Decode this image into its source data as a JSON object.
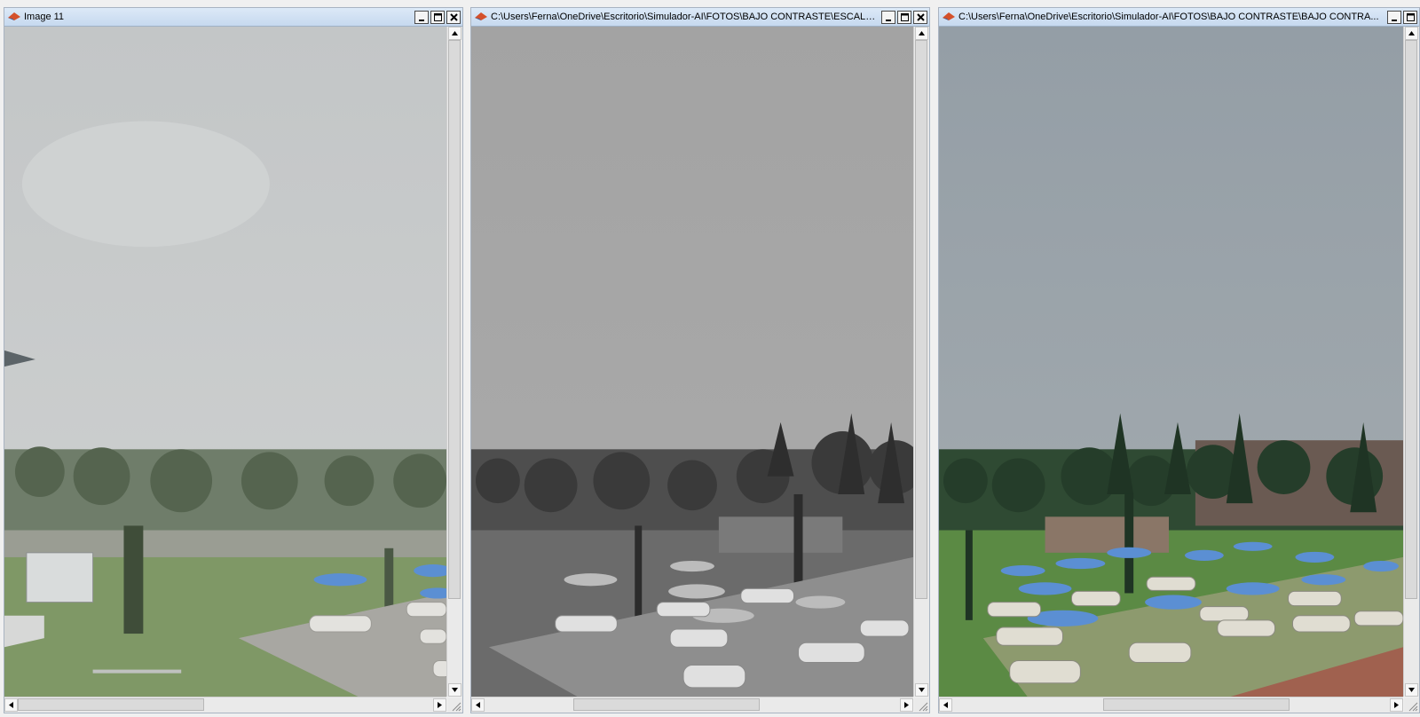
{
  "windows": [
    {
      "title": "Image 11",
      "variant": "washed",
      "buttons": {
        "minimize": "_",
        "maximize": "□",
        "close": "✕"
      }
    },
    {
      "title": "C:\\Users\\Ferna\\OneDrive\\Escritorio\\Simulador-AI\\FOTOS\\BAJO CONTRASTE\\ESCALA DE GRI...",
      "variant": "grayscale",
      "buttons": {
        "minimize": "_",
        "maximize": "□",
        "close": "✕"
      }
    },
    {
      "title": "C:\\Users\\Ferna\\OneDrive\\Escritorio\\Simulador-AI\\FOTOS\\BAJO CONTRASTE\\BAJO CONTRA...",
      "variant": "color",
      "buttons": {
        "minimize": "_",
        "maximize": "□",
        "close": ""
      }
    }
  ],
  "icons": {
    "app": "matlab-figure-icon",
    "minimize": "minimize-icon",
    "maximize": "maximize-icon",
    "close": "close-icon",
    "scroll_up": "arrow-up-icon",
    "scroll_down": "arrow-down-icon",
    "scroll_left": "arrow-left-icon",
    "scroll_right": "arrow-right-icon",
    "resize_grip": "resize-grip-icon"
  },
  "colors": {
    "sky_washed": "#c9cbcc",
    "sky_gray": "#a6a6a6",
    "sky_color": "#9aa6ae",
    "umbrella_blue": "#5b8fd3",
    "grass": "#6f9a4e"
  }
}
